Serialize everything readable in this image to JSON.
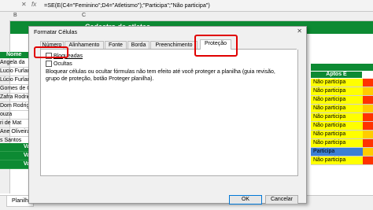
{
  "formula_bar": {
    "cancel_icon": "x-icon",
    "fx_label": "fx",
    "formula": "=SE(E(C4=\"Feminino\";D4=\"Atletismo\");\"Participa\";\"Não participa\")"
  },
  "columns": [
    "B",
    "C"
  ],
  "sheet": {
    "title": "Cadastro de atletas",
    "name_header": "Nome",
    "names": [
      "Angela da",
      "Lucio Furlan",
      "Lúcio Furlan",
      "Gomes de C",
      "Zafra Rodrigu",
      "Dom Rodrigu",
      "ouza",
      "ri de Mat",
      "Ane Oliveira",
      "s Santos",
      "",
      ""
    ],
    "v_labels": [
      "Va",
      "Va",
      "Va"
    ],
    "aptos_header": "Aptos E",
    "aptos": [
      "Não participa",
      "Não participa",
      "Não participa",
      "Não participa",
      "Não participa",
      "Não participa",
      "Não participa",
      "Não participa",
      "Participa",
      "Não participa",
      "",
      ""
    ],
    "tab_label": "Planilh"
  },
  "dialog": {
    "title": "Formatar Células",
    "tabs": [
      "Número",
      "Alinhamento",
      "Fonte",
      "Borda",
      "Preenchimento",
      "Proteção"
    ],
    "locked_label": "Bloqueadas",
    "hidden_label": "Ocultas",
    "description": "Bloquear células ou ocultar fórmulas não tem efeito até você proteger a planilha (guia revisão, grupo de proteção, botão Proteger planilha).",
    "ok_label": "OK",
    "cancel_label": "Cancelar"
  },
  "colors": {
    "green": "#0d8a33",
    "yellow": "#ffff00",
    "blue": "#3b7fd4",
    "highlight_red": "#e00000"
  }
}
